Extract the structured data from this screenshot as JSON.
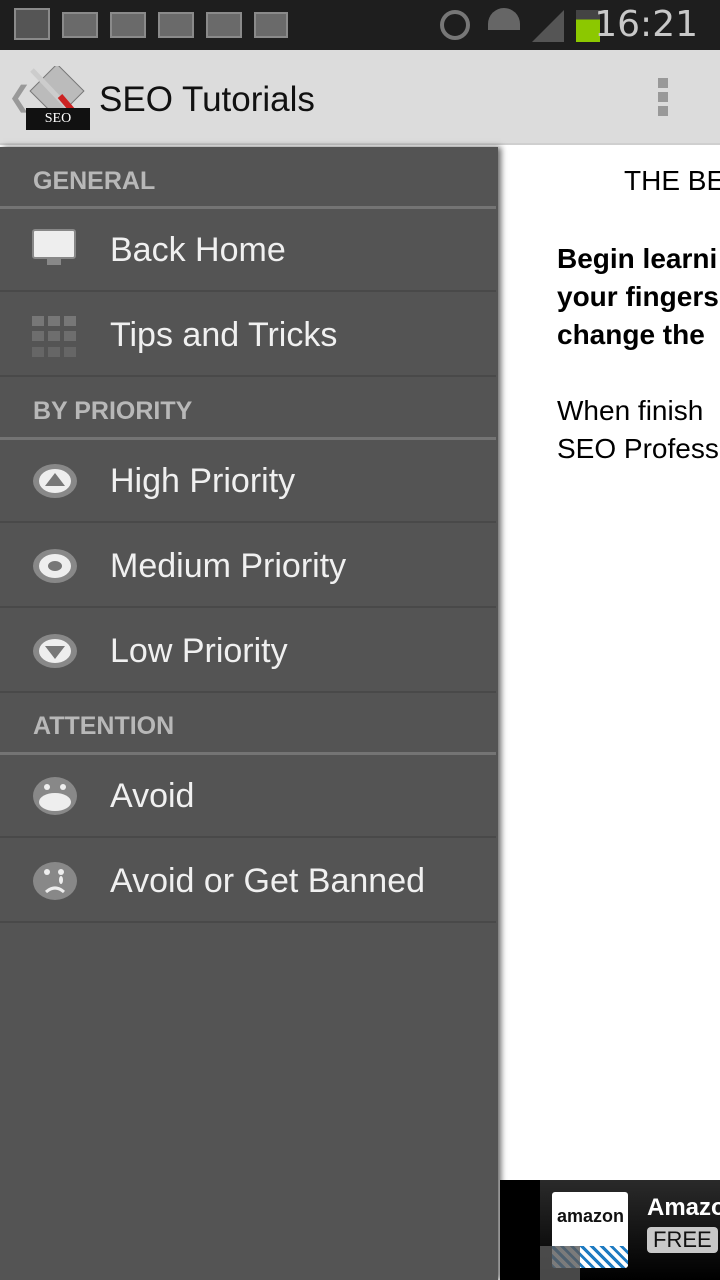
{
  "status_bar": {
    "time": "16:21",
    "icons": [
      "gallery-icon",
      "email-icon",
      "email-icon",
      "email-icon",
      "email-icon",
      "gmail-icon",
      "alarm-icon",
      "wifi-icon",
      "signal-icon",
      "battery-icon"
    ],
    "battery_color": "#8cc800"
  },
  "action_bar": {
    "title": "SEO Tutorials",
    "logo_text": "SEO"
  },
  "drawer": {
    "sections": [
      {
        "header": "GENERAL",
        "items": [
          {
            "label": "Back Home",
            "icon": "monitor-icon"
          },
          {
            "label": "Tips and Tricks",
            "icon": "grid-icon"
          }
        ]
      },
      {
        "header": "BY PRIORITY",
        "items": [
          {
            "label": "High Priority",
            "icon": "arrow-up-circle-icon"
          },
          {
            "label": "Medium Priority",
            "icon": "dot-circle-icon"
          },
          {
            "label": "Low Priority",
            "icon": "arrow-down-circle-icon"
          }
        ]
      },
      {
        "header": "ATTENTION",
        "items": [
          {
            "label": "Avoid",
            "icon": "shocked-face-icon"
          },
          {
            "label": "Avoid or Get Banned",
            "icon": "crying-face-icon"
          }
        ]
      }
    ]
  },
  "content": {
    "heading": "THE BE",
    "bold_lines": [
      "Begin learni",
      "your fingers",
      "change the"
    ],
    "lines": [
      "When finish",
      "SEO Profess"
    ]
  },
  "ad": {
    "logo_text": "amazon",
    "title": "Amazo",
    "badge": "FREE"
  }
}
